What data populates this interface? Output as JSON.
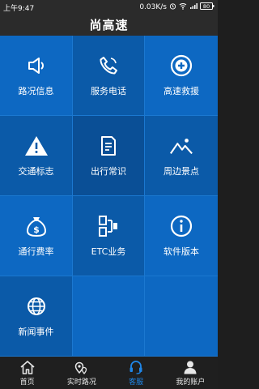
{
  "statusbar": {
    "time": "上午9:47",
    "speed": "0.03K/s",
    "battery": "80"
  },
  "header": {
    "title": "尚高速"
  },
  "tiles": [
    {
      "label": "路况信息",
      "icon": "speaker-icon"
    },
    {
      "label": "服务电话",
      "icon": "phone-icon"
    },
    {
      "label": "高速救援",
      "icon": "plus-circle-icon"
    },
    {
      "label": "交通标志",
      "icon": "warning-icon"
    },
    {
      "label": "出行常识",
      "icon": "document-icon"
    },
    {
      "label": "周边景点",
      "icon": "mountain-icon"
    },
    {
      "label": "通行费率",
      "icon": "money-bag-icon"
    },
    {
      "label": "ETC业务",
      "icon": "etc-icon"
    },
    {
      "label": "软件版本",
      "icon": "info-icon"
    },
    {
      "label": "新闻事件",
      "icon": "globe-icon"
    }
  ],
  "tabs": [
    {
      "label": "首页",
      "icon": "home-icon"
    },
    {
      "label": "实时路况",
      "icon": "location-pin-icon"
    },
    {
      "label": "客服",
      "icon": "headset-icon"
    },
    {
      "label": "我的账户",
      "icon": "user-icon"
    }
  ],
  "colors": {
    "accent": "#1f86e8",
    "grid_bg": "#0f5fae"
  }
}
